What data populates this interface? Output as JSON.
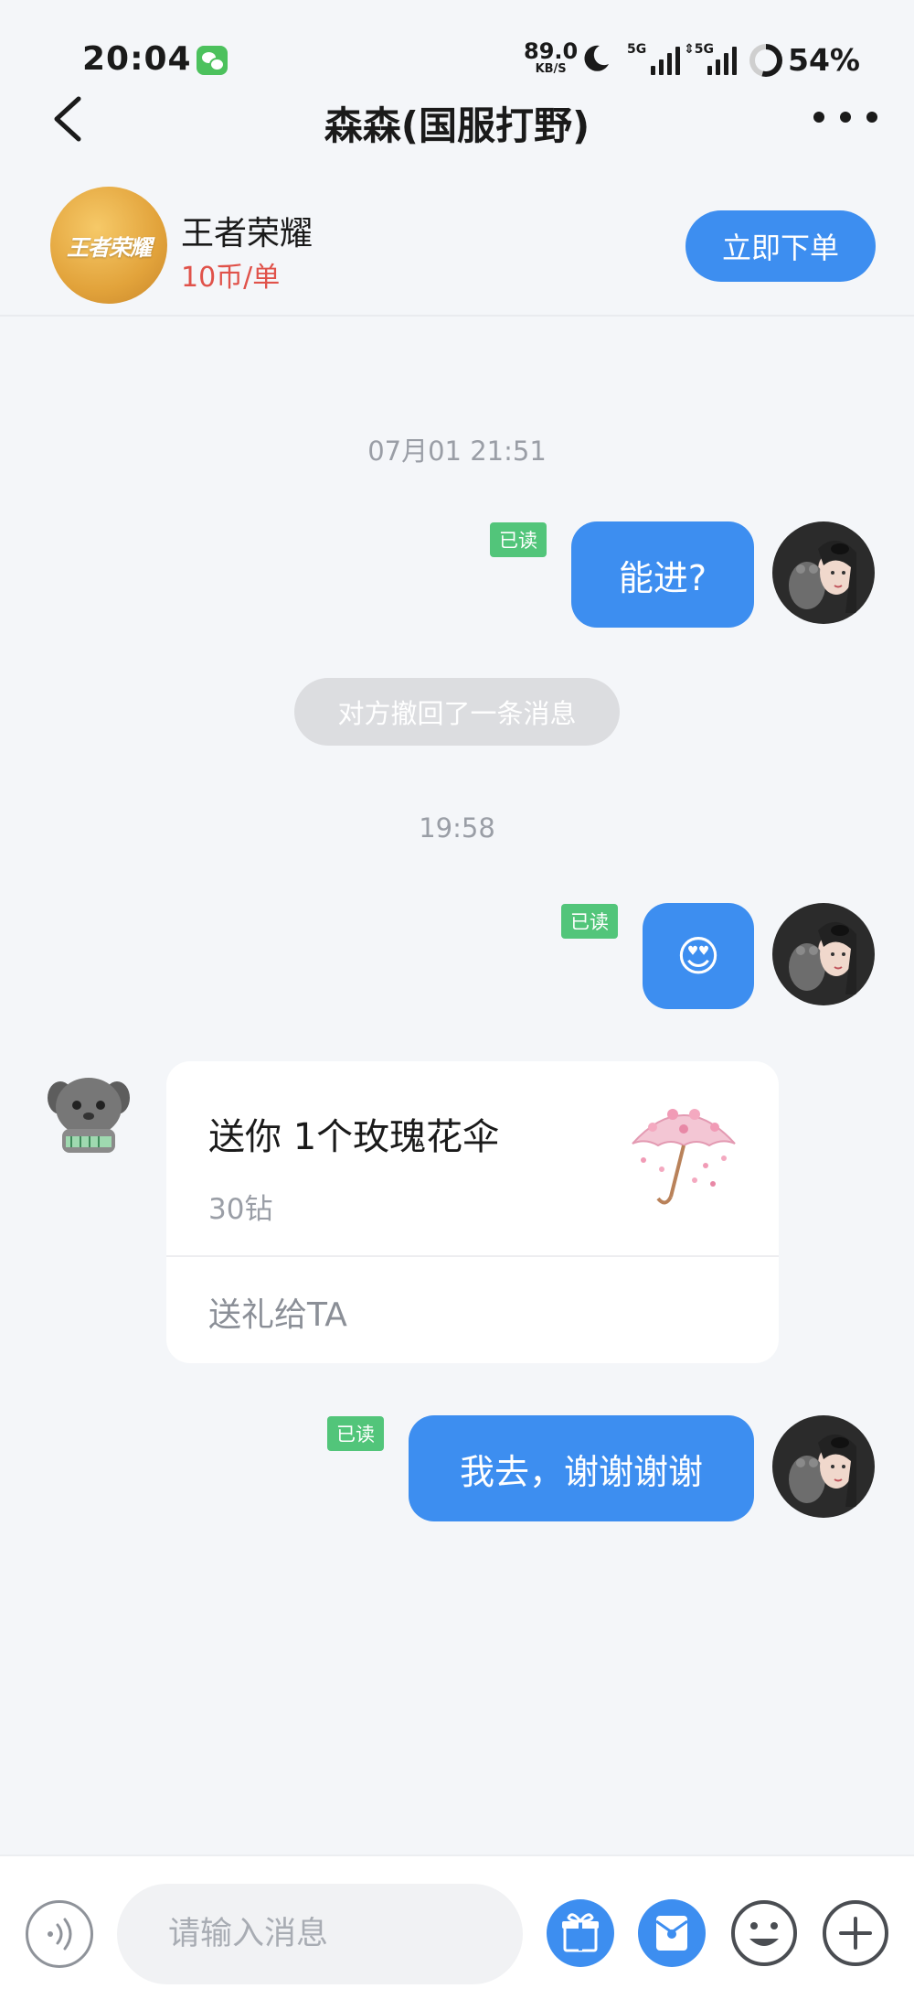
{
  "status_bar": {
    "time": "20:04",
    "net_speed_value": "89.0",
    "net_speed_unit": "KB/S",
    "signal_1_tag": "5G",
    "signal_2_tag": "⇕5G",
    "battery": "54%",
    "battery_level": 0.54,
    "icons": [
      "wechat-icon",
      "moon-icon",
      "signal-icon",
      "battery-icon"
    ]
  },
  "header": {
    "title": "森森(国服打野)"
  },
  "game_card": {
    "logo_text": "王者荣耀",
    "name": "王者荣耀",
    "price": "10币/单",
    "order_label": "立即下单"
  },
  "messages": {
    "timestamp_1": "07月01 21:51",
    "msg_1": "能进?",
    "read_label": "已读",
    "recall_notice": "对方撤回了一条消息",
    "timestamp_2": "19:58",
    "msg_2_emoji": "😍",
    "gift": {
      "title": "送你 1个玫瑰花伞",
      "price": "30钻",
      "action": "送礼给TA"
    },
    "msg_3": "我去，谢谢谢谢"
  },
  "input_bar": {
    "placeholder": "请输入消息"
  },
  "colors": {
    "accent": "#3d8ef0",
    "read_badge": "#52c57a",
    "price": "#e0524a",
    "background": "#f4f6f9"
  }
}
